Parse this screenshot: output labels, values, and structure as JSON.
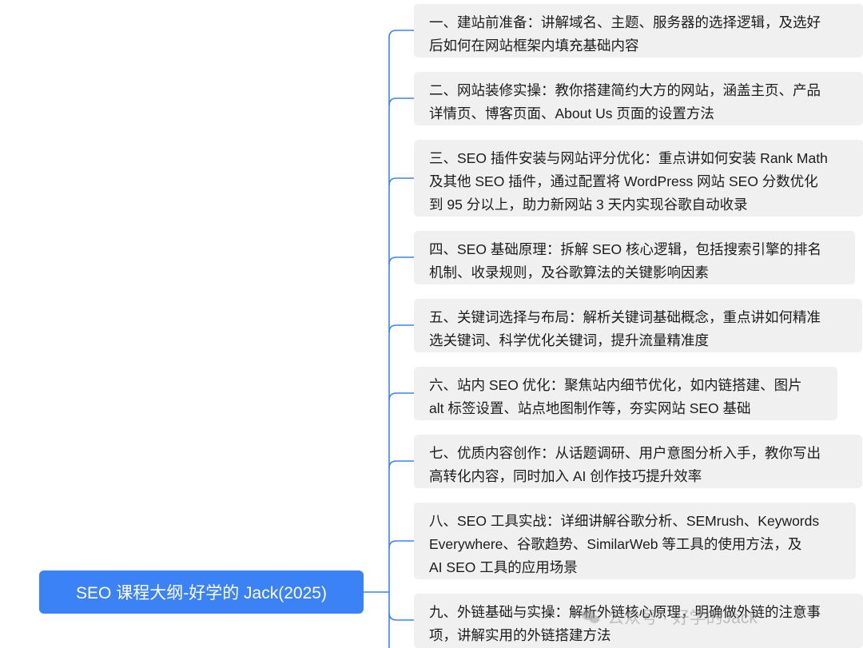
{
  "root": {
    "label": "SEO 课程大纲-好学的 Jack(2025)"
  },
  "topics": [
    {
      "lines": [
        "一、建站前准备：讲解域名、主题、服务器的选择逻辑，及选好",
        "后如何在网站框架内填充基础内容"
      ]
    },
    {
      "lines": [
        "二、网站装修实操：教你搭建简约大方的网站，涵盖主页、产品",
        "详情页、博客页面、About Us 页面的设置方法"
      ]
    },
    {
      "lines": [
        "三、SEO 插件安装与网站评分优化：重点讲如何安装 Rank Math",
        "及其他 SEO 插件，通过配置将 WordPress 网站 SEO 分数优化",
        "到 95 分以上，助力新网站 3 天内实现谷歌自动收录"
      ]
    },
    {
      "lines": [
        "四、SEO 基础原理：拆解 SEO 核心逻辑，包括搜索引擎的排名",
        "机制、收录规则，及谷歌算法的关键影响因素"
      ]
    },
    {
      "lines": [
        "五、关键词选择与布局：解析关键词基础概念，重点讲如何精准",
        "选关键词、科学优化关键词，提升流量精准度"
      ]
    },
    {
      "lines": [
        "六、站内 SEO 优化：聚焦站内细节优化，如内链搭建、图片",
        "alt 标签设置、站点地图制作等，夯实网站 SEO 基础"
      ]
    },
    {
      "lines": [
        "七、优质内容创作：从话题调研、用户意图分析入手，教你写出",
        "高转化内容，同时加入 AI 创作技巧提升效率"
      ]
    },
    {
      "lines": [
        "八、SEO 工具实战：详细讲解谷歌分析、SEMrush、Keywords",
        "Everywhere、谷歌趋势、SimilarWeb 等工具的使用方法，及",
        "AI SEO 工具的应用场景"
      ]
    },
    {
      "lines": [
        "九、外链基础与实操：解析外链核心原理，明确做外链的注意事",
        "项，讲解实用的外链搭建方法"
      ]
    }
  ],
  "watermark": {
    "text": "公众号 · 好学的Jack"
  },
  "colors": {
    "root_fill": "#3b82f6",
    "connector": "#3b82f6",
    "topic_fill": "#f0f0f0",
    "text": "#1c1c1c"
  }
}
